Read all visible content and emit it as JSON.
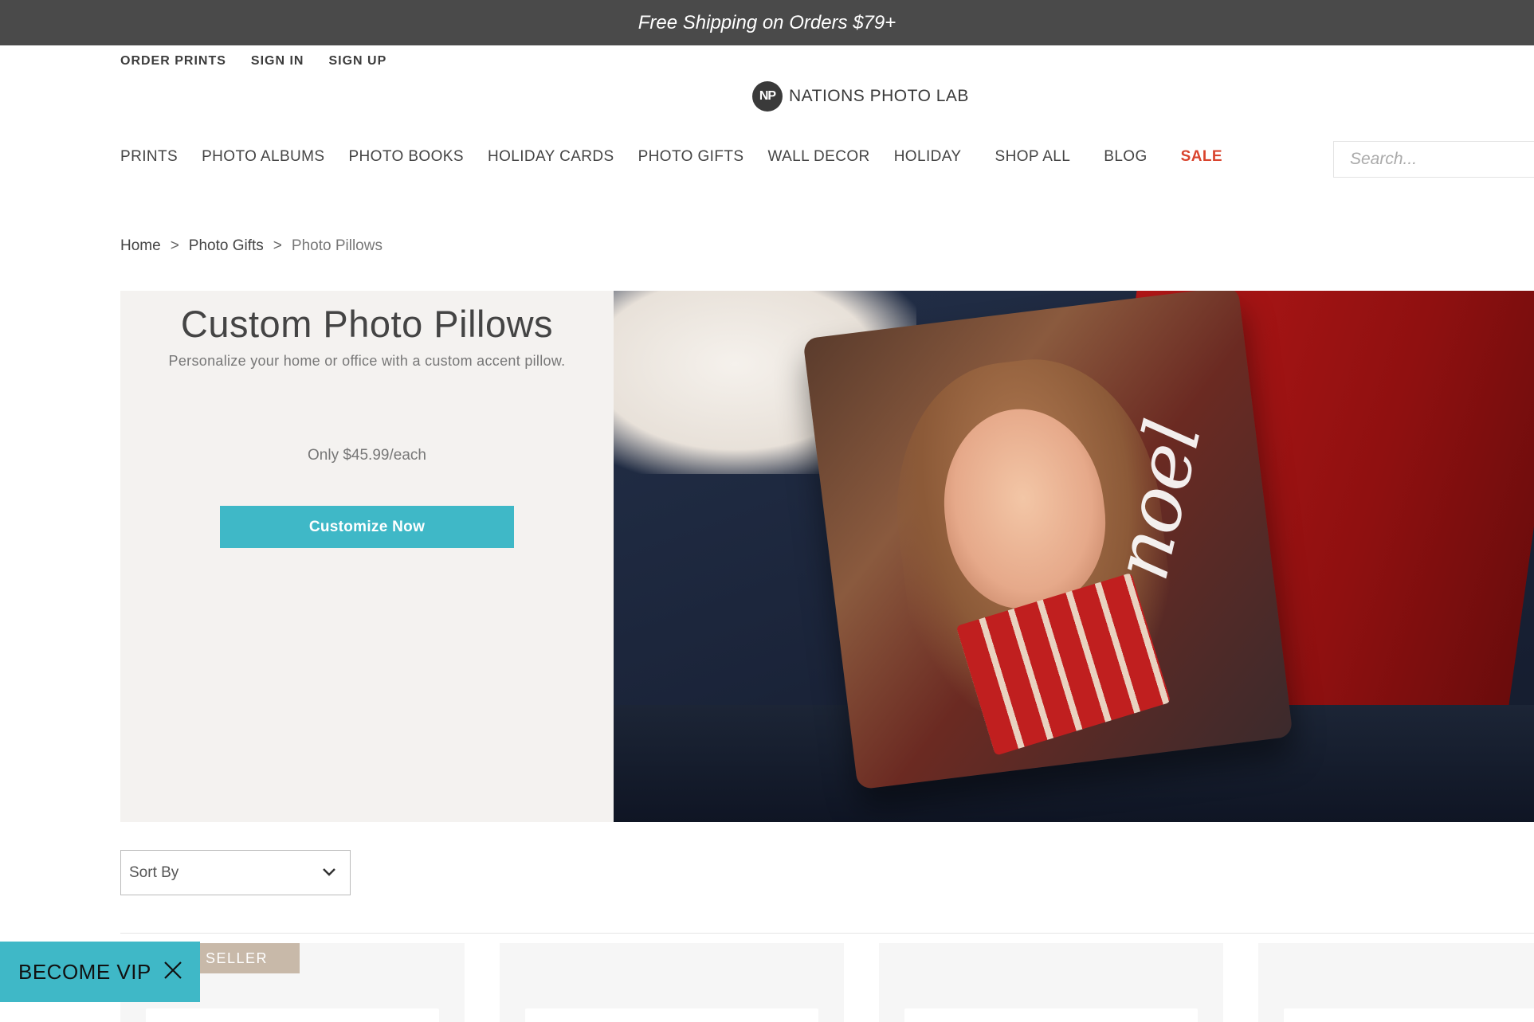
{
  "promo": {
    "text": "Free Shipping on Orders $79+"
  },
  "top_links": [
    "ORDER PRINTS",
    "SIGN IN",
    "SIGN UP"
  ],
  "logo": {
    "mark": "NP",
    "text": "NATIONS PHOTO LAB"
  },
  "nav": [
    "PRINTS",
    "PHOTO ALBUMS",
    "PHOTO BOOKS",
    "HOLIDAY CARDS",
    "PHOTO GIFTS",
    "WALL DECOR",
    "HOLIDAY",
    "SHOP ALL",
    "BLOG",
    "SALE"
  ],
  "search": {
    "placeholder": "Search..."
  },
  "breadcrumb": {
    "home": "Home",
    "sep": ">",
    "parent": "Photo Gifts",
    "current": "Photo Pillows"
  },
  "hero": {
    "title": "Custom Photo Pillows",
    "subtitle": "Personalize your home or office with a custom accent pillow.",
    "price": "Only $45.99/each",
    "cta": "Customize Now",
    "image_text": "noel"
  },
  "sort": {
    "label": "Sort By"
  },
  "product_badge": "SELLER",
  "vip": {
    "label": "BECOME VIP"
  },
  "colors": {
    "accent": "#3fb8c7",
    "sale": "#d9442e",
    "promo_bg": "#4a4a4a",
    "hero_panel": "#f4f2f0"
  },
  "icons": {
    "close": "close-icon",
    "dropdown": "chevron-down-icon"
  }
}
